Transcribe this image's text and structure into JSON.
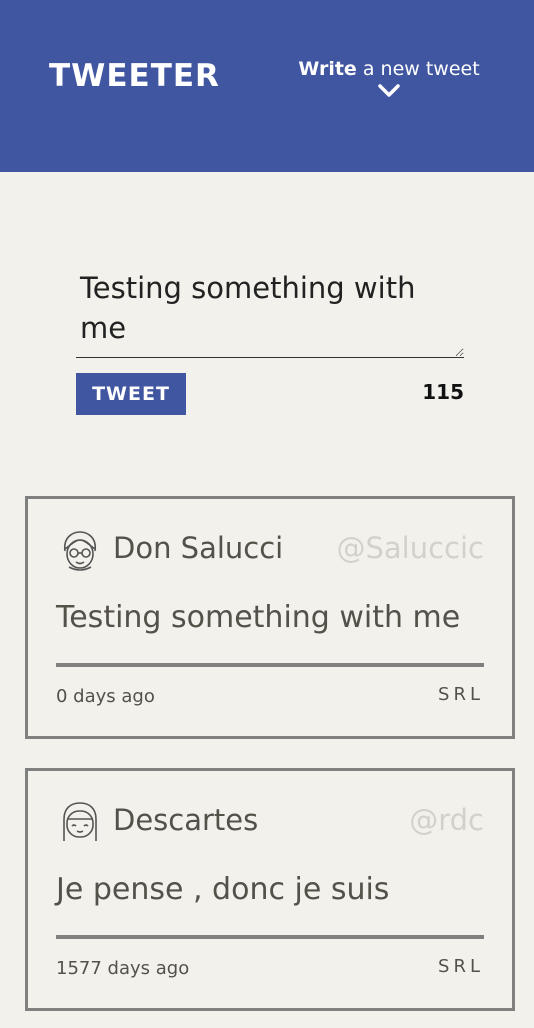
{
  "header": {
    "brand": "TWEETER",
    "compose_toggle": {
      "bold": "Write",
      "rest": "a new tweet"
    }
  },
  "composer": {
    "text": "Testing something with me",
    "button_label": "TWEET",
    "char_count": "115"
  },
  "tweets": [
    {
      "name": "Don Salucci",
      "handle": "@Saluccic",
      "text": "Testing something with me",
      "time": "0 days ago",
      "actions": [
        "S",
        "R",
        "L"
      ]
    },
    {
      "name": "Descartes",
      "handle": "@rdc",
      "text": "Je pense , donc je suis",
      "time": "1577 days ago",
      "actions": [
        "S",
        "R",
        "L"
      ]
    }
  ],
  "colors": {
    "accent": "#4056a1",
    "background": "#f3f1ec",
    "text": "#545149",
    "muted": "#d3d1cc",
    "border": "#808080"
  }
}
